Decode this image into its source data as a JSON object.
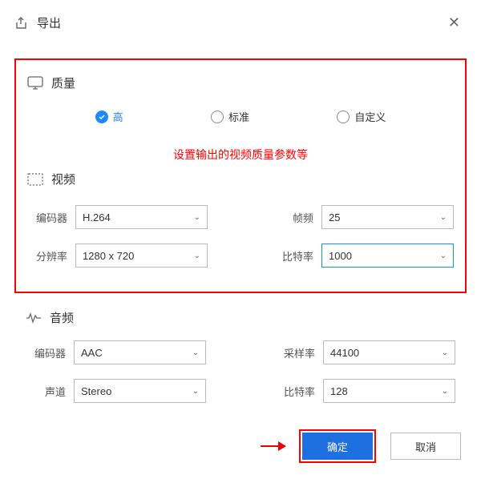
{
  "titlebar": {
    "title": "导出"
  },
  "sections": {
    "quality": {
      "title": "质量",
      "options": {
        "high": "高",
        "standard": "标准",
        "custom": "自定义"
      },
      "selected": "high"
    },
    "video": {
      "title": "视频",
      "fields": {
        "encoder": {
          "label": "编码器",
          "value": "H.264"
        },
        "fps": {
          "label": "帧频",
          "value": "25"
        },
        "resolution": {
          "label": "分辨率",
          "value": "1280 x 720"
        },
        "bitrate": {
          "label": "比特率",
          "value": "1000"
        }
      }
    },
    "audio": {
      "title": "音频",
      "fields": {
        "encoder": {
          "label": "编码器",
          "value": "AAC"
        },
        "sampleRate": {
          "label": "采样率",
          "value": "44100"
        },
        "channels": {
          "label": "声道",
          "value": "Stereo"
        },
        "bitrate": {
          "label": "比特率",
          "value": "128"
        }
      }
    }
  },
  "annotation": "设置输出的视频质量参数等",
  "buttons": {
    "ok": "确定",
    "cancel": "取消"
  }
}
